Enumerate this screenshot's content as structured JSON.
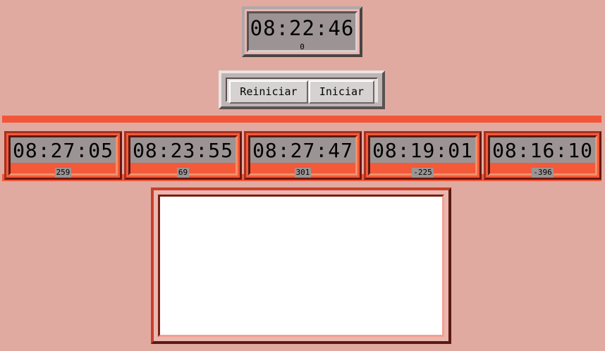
{
  "main_clock": {
    "time": "08:22:46",
    "offset": "0"
  },
  "controls": {
    "reset_label": "Reiniciar",
    "start_label": "Iniciar"
  },
  "nodes": [
    {
      "time": "08:27:05",
      "offset": "259"
    },
    {
      "time": "08:23:55",
      "offset": "69"
    },
    {
      "time": "08:27:47",
      "offset": "301"
    },
    {
      "time": "08:19:01",
      "offset": "-225"
    },
    {
      "time": "08:16:10",
      "offset": "-396"
    }
  ],
  "log": {
    "content": ""
  },
  "colors": {
    "background": "#e1aaa0",
    "node_accent": "#f2563a",
    "display": "#9c9494"
  }
}
